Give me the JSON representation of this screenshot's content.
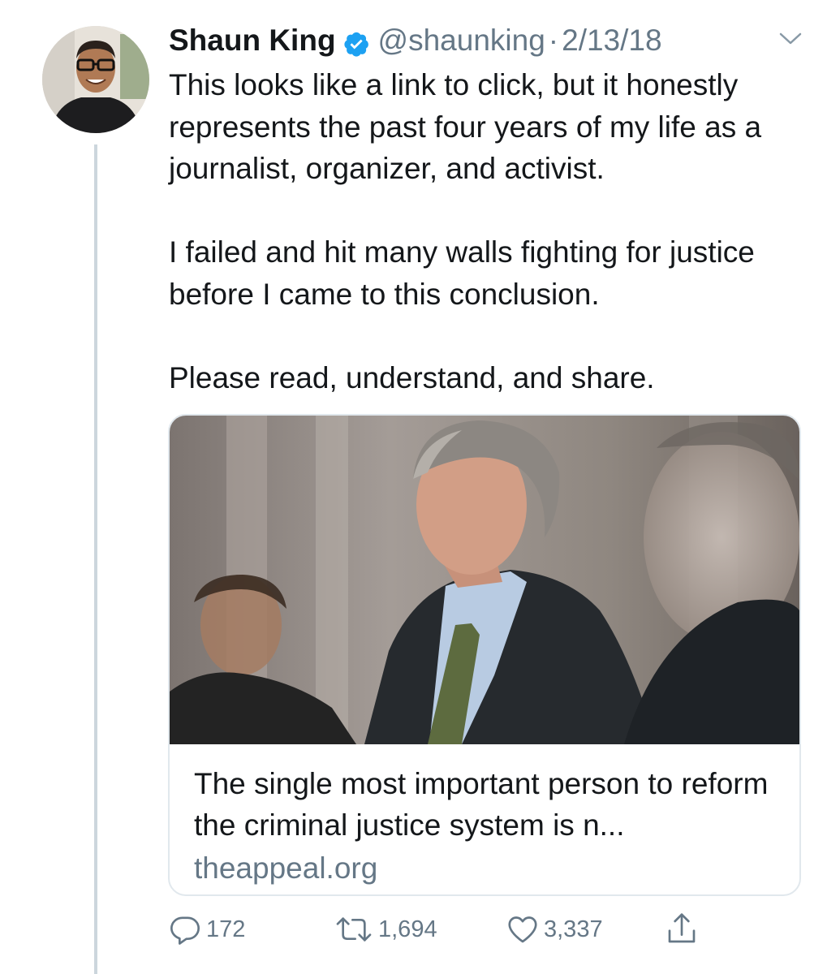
{
  "tweet": {
    "author": {
      "name": "Shaun King",
      "handle": "@shaunking",
      "date": "2/13/18",
      "separator": "·",
      "verified": true
    },
    "text_paragraphs": [
      "This looks like a link to click, but it honestly represents the past four years of my life as a journalist, organizer, and activist.",
      "I failed and hit many walls fighting for justice before I came to this conclusion.",
      "Please read, understand, and share."
    ],
    "card": {
      "title": "The single most important person to reform the criminal justice system is n...",
      "domain": "theappeal.org"
    },
    "actions": {
      "replies": "172",
      "retweets": "1,694",
      "likes": "3,337"
    }
  },
  "colors": {
    "verified": "#1da1f2",
    "text": "#14171a",
    "muted": "#657786",
    "border": "#e1e8ed",
    "thread_line": "#ccd6dd"
  },
  "icons": {
    "verified": "verified-badge-icon",
    "caret": "chevron-down-icon",
    "reply": "reply-icon",
    "retweet": "retweet-icon",
    "like": "heart-icon",
    "share": "share-icon"
  }
}
